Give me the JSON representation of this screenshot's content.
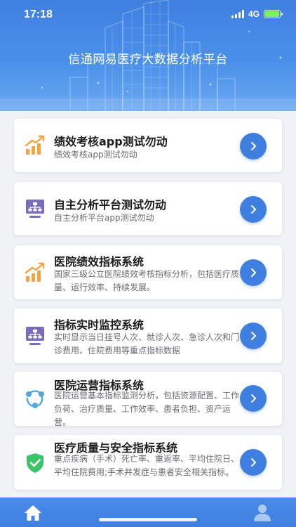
{
  "status_bar": {
    "time": "17:18",
    "network": "4G",
    "battery_level": 1.0,
    "battery_color": "#7cf25a"
  },
  "header": {
    "title": "信通网易医疗大数据分析平台",
    "background_color": "#3f7fe0"
  },
  "cards": [
    {
      "title": "绩效考核app测试勿动",
      "description": "绩效考核app测试勿动",
      "icon": "bar-chart-trend-icon",
      "icon_color": "#f4a340"
    },
    {
      "title": "自主分析平台测试勿动",
      "description": "自主分析平台app测试勿动",
      "icon": "org-chart-monitor-icon",
      "icon_color": "#7b6cc0"
    },
    {
      "title": "医院绩效指标系统",
      "description": "国家三级公立医院绩效考核指标分析，包括医疗质量、运行效率、持续发展。",
      "icon": "bar-chart-trend-icon",
      "icon_color": "#f4a340"
    },
    {
      "title": "指标实时监控系统",
      "description": "实时显示当日挂号人次、就诊人次、急诊人次和门诊费用、住院费用等重点指标数据",
      "icon": "org-chart-monitor-icon",
      "icon_color": "#7b6cc0"
    },
    {
      "title": "医院运营指标系统",
      "description": "医院运营基本指标监测分析，包括资源配置、工作负荷、治疗质量、工作效率、患者负担、资产运营。",
      "icon": "cycle-nodes-icon",
      "icon_color": "#4fa8d8"
    },
    {
      "title": "医疗质量与安全指标系统",
      "description": "重点疾病（手术）死亡率、重返率、平均住院日、平均住院费用;手术并发症与患者安全相关指标。",
      "icon": "shield-check-icon",
      "icon_color": "#3dc46a"
    }
  ],
  "accent_color": "#3f7fe0",
  "tabbar": {
    "items": [
      {
        "icon": "home-icon",
        "active": true
      },
      {
        "icon": "user-icon",
        "active": false
      }
    ]
  }
}
